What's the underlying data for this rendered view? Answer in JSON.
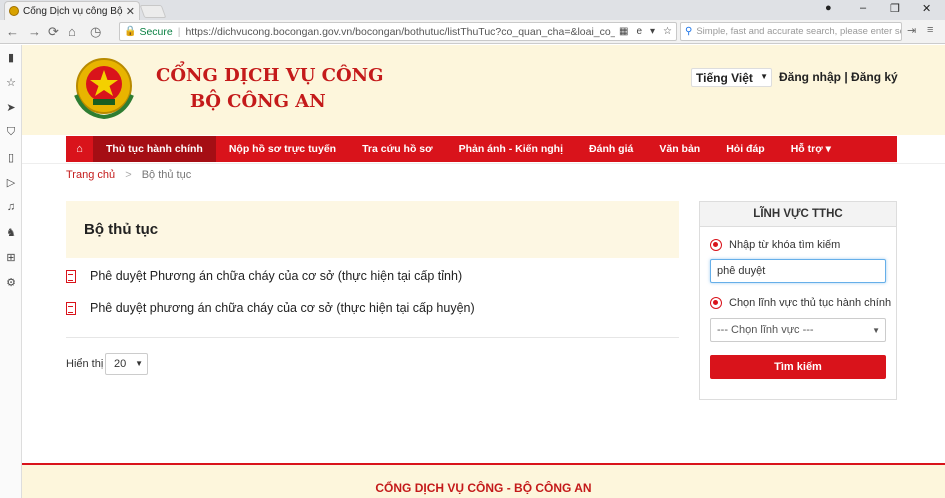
{
  "browser": {
    "tab_title": "Cổng Dịch vụ công Bộ Cô",
    "tab_close": "✕",
    "window_controls": {
      "user": "●",
      "minimize": "–",
      "maximize": "❐",
      "close": "✕"
    },
    "nav": {
      "back": "←",
      "forward": "→",
      "reload": "⟳",
      "home": "⌂",
      "history": "◷"
    },
    "secure_label": "Secure",
    "url": "https://dichvucong.bocongan.gov.vn/bocongan/bothutuc/listThuTuc?co_quan_cha=&loai_co_qu...",
    "search_placeholder": "Simple, fast and accurate search, please enter se..."
  },
  "sidebar_icons": [
    "bookmark-icon",
    "star-icon",
    "send-icon",
    "shield-icon",
    "phone-icon",
    "play-icon",
    "music-icon",
    "game-icon",
    "apps-icon",
    "settings-icon"
  ],
  "header": {
    "brand_line1": "CỔNG DỊCH VỤ CÔNG",
    "brand_line2": "BỘ CÔNG AN",
    "language": "Tiếng Việt",
    "login": "Đăng nhập",
    "separator": "|",
    "register": "Đăng ký"
  },
  "navbar": {
    "items": [
      {
        "label": "Thủ tục hành chính",
        "active": true
      },
      {
        "label": "Nộp hồ sơ trực tuyến"
      },
      {
        "label": "Tra cứu hồ sơ"
      },
      {
        "label": "Phản ánh - Kiến nghị"
      },
      {
        "label": "Đánh giá"
      },
      {
        "label": "Văn bản"
      },
      {
        "label": "Hỏi đáp"
      },
      {
        "label": "Hỗ trợ ▾"
      }
    ]
  },
  "breadcrumb": {
    "home": "Trang chủ",
    "separator": ">",
    "current": "Bộ thủ tục"
  },
  "main": {
    "title": "Bộ thủ tục",
    "procedures": [
      "Phê duyệt Phương án chữa cháy của cơ sở (thực hiện tại cấp tỉnh)",
      "Phê duyệt phương án chữa cháy của cơ sở (thực hiện tại cấp huyện)"
    ],
    "show_label": "Hiển thị",
    "page_size": "20"
  },
  "filter_panel": {
    "title": "LĨNH VỰC TTHC",
    "keyword_label": "Nhập từ khóa tìm kiếm",
    "keyword_value": "phê duyệt",
    "field_label": "Chọn lĩnh vực thủ tục hành chính",
    "field_value": "--- Chọn lĩnh vực ---",
    "search_button": "Tìm kiếm"
  },
  "footer": {
    "text": "CỔNG DỊCH VỤ CÔNG - BỘ CÔNG AN"
  },
  "colors": {
    "primary_red": "#d9131b",
    "header_bg": "#fdf6dc",
    "brand_red": "#c41a1a"
  }
}
